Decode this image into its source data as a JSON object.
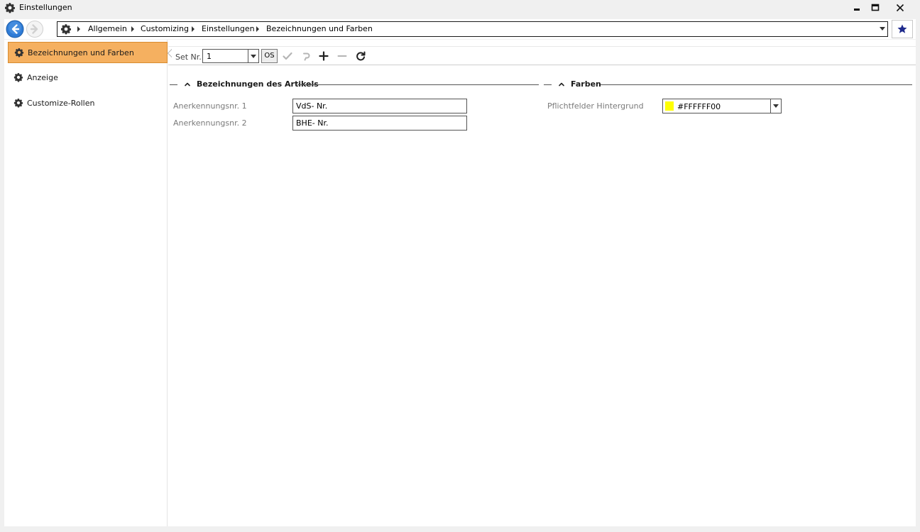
{
  "window": {
    "title": "Einstellungen"
  },
  "breadcrumb": {
    "items": [
      "Allgemein",
      "Customizing",
      "Einstellungen",
      "Bezeichnungen und Farben"
    ]
  },
  "sidebar": {
    "items": [
      {
        "label": "Bezeichnungen und Farben",
        "active": true
      },
      {
        "label": "Anzeige",
        "active": false
      },
      {
        "label": "Customize-Rollen",
        "active": false
      }
    ]
  },
  "toolbar": {
    "set_label": "Set Nr.",
    "set_value": "1",
    "os_label": "OS"
  },
  "groups": {
    "articles": {
      "title": "Bezeichnungen des Artikels",
      "fields": [
        {
          "label": "Anerkennungsnr. 1",
          "value": "VdS- Nr."
        },
        {
          "label": "Anerkennungsnr. 2",
          "value": "BHE- Nr."
        }
      ]
    },
    "colors": {
      "title": "Farben",
      "field_label": "Pflichtfelder Hintergrund",
      "color_value": "#FFFFFF00",
      "swatch_color": "#FFFF00"
    }
  },
  "colors": {
    "active_item_bg": "#F5B060",
    "nav_arrow_blue": "#2E7BD6",
    "favorite_star": "#1E2A8C"
  },
  "icons": {
    "app": "gear-icon",
    "back": "back-arrow-icon",
    "forward": "forward-arrow-icon",
    "favorite": "star-icon",
    "save": "checkmark-icon",
    "undo": "undo-icon",
    "add": "plus-icon",
    "remove": "minus-icon",
    "refresh": "refresh-icon"
  }
}
